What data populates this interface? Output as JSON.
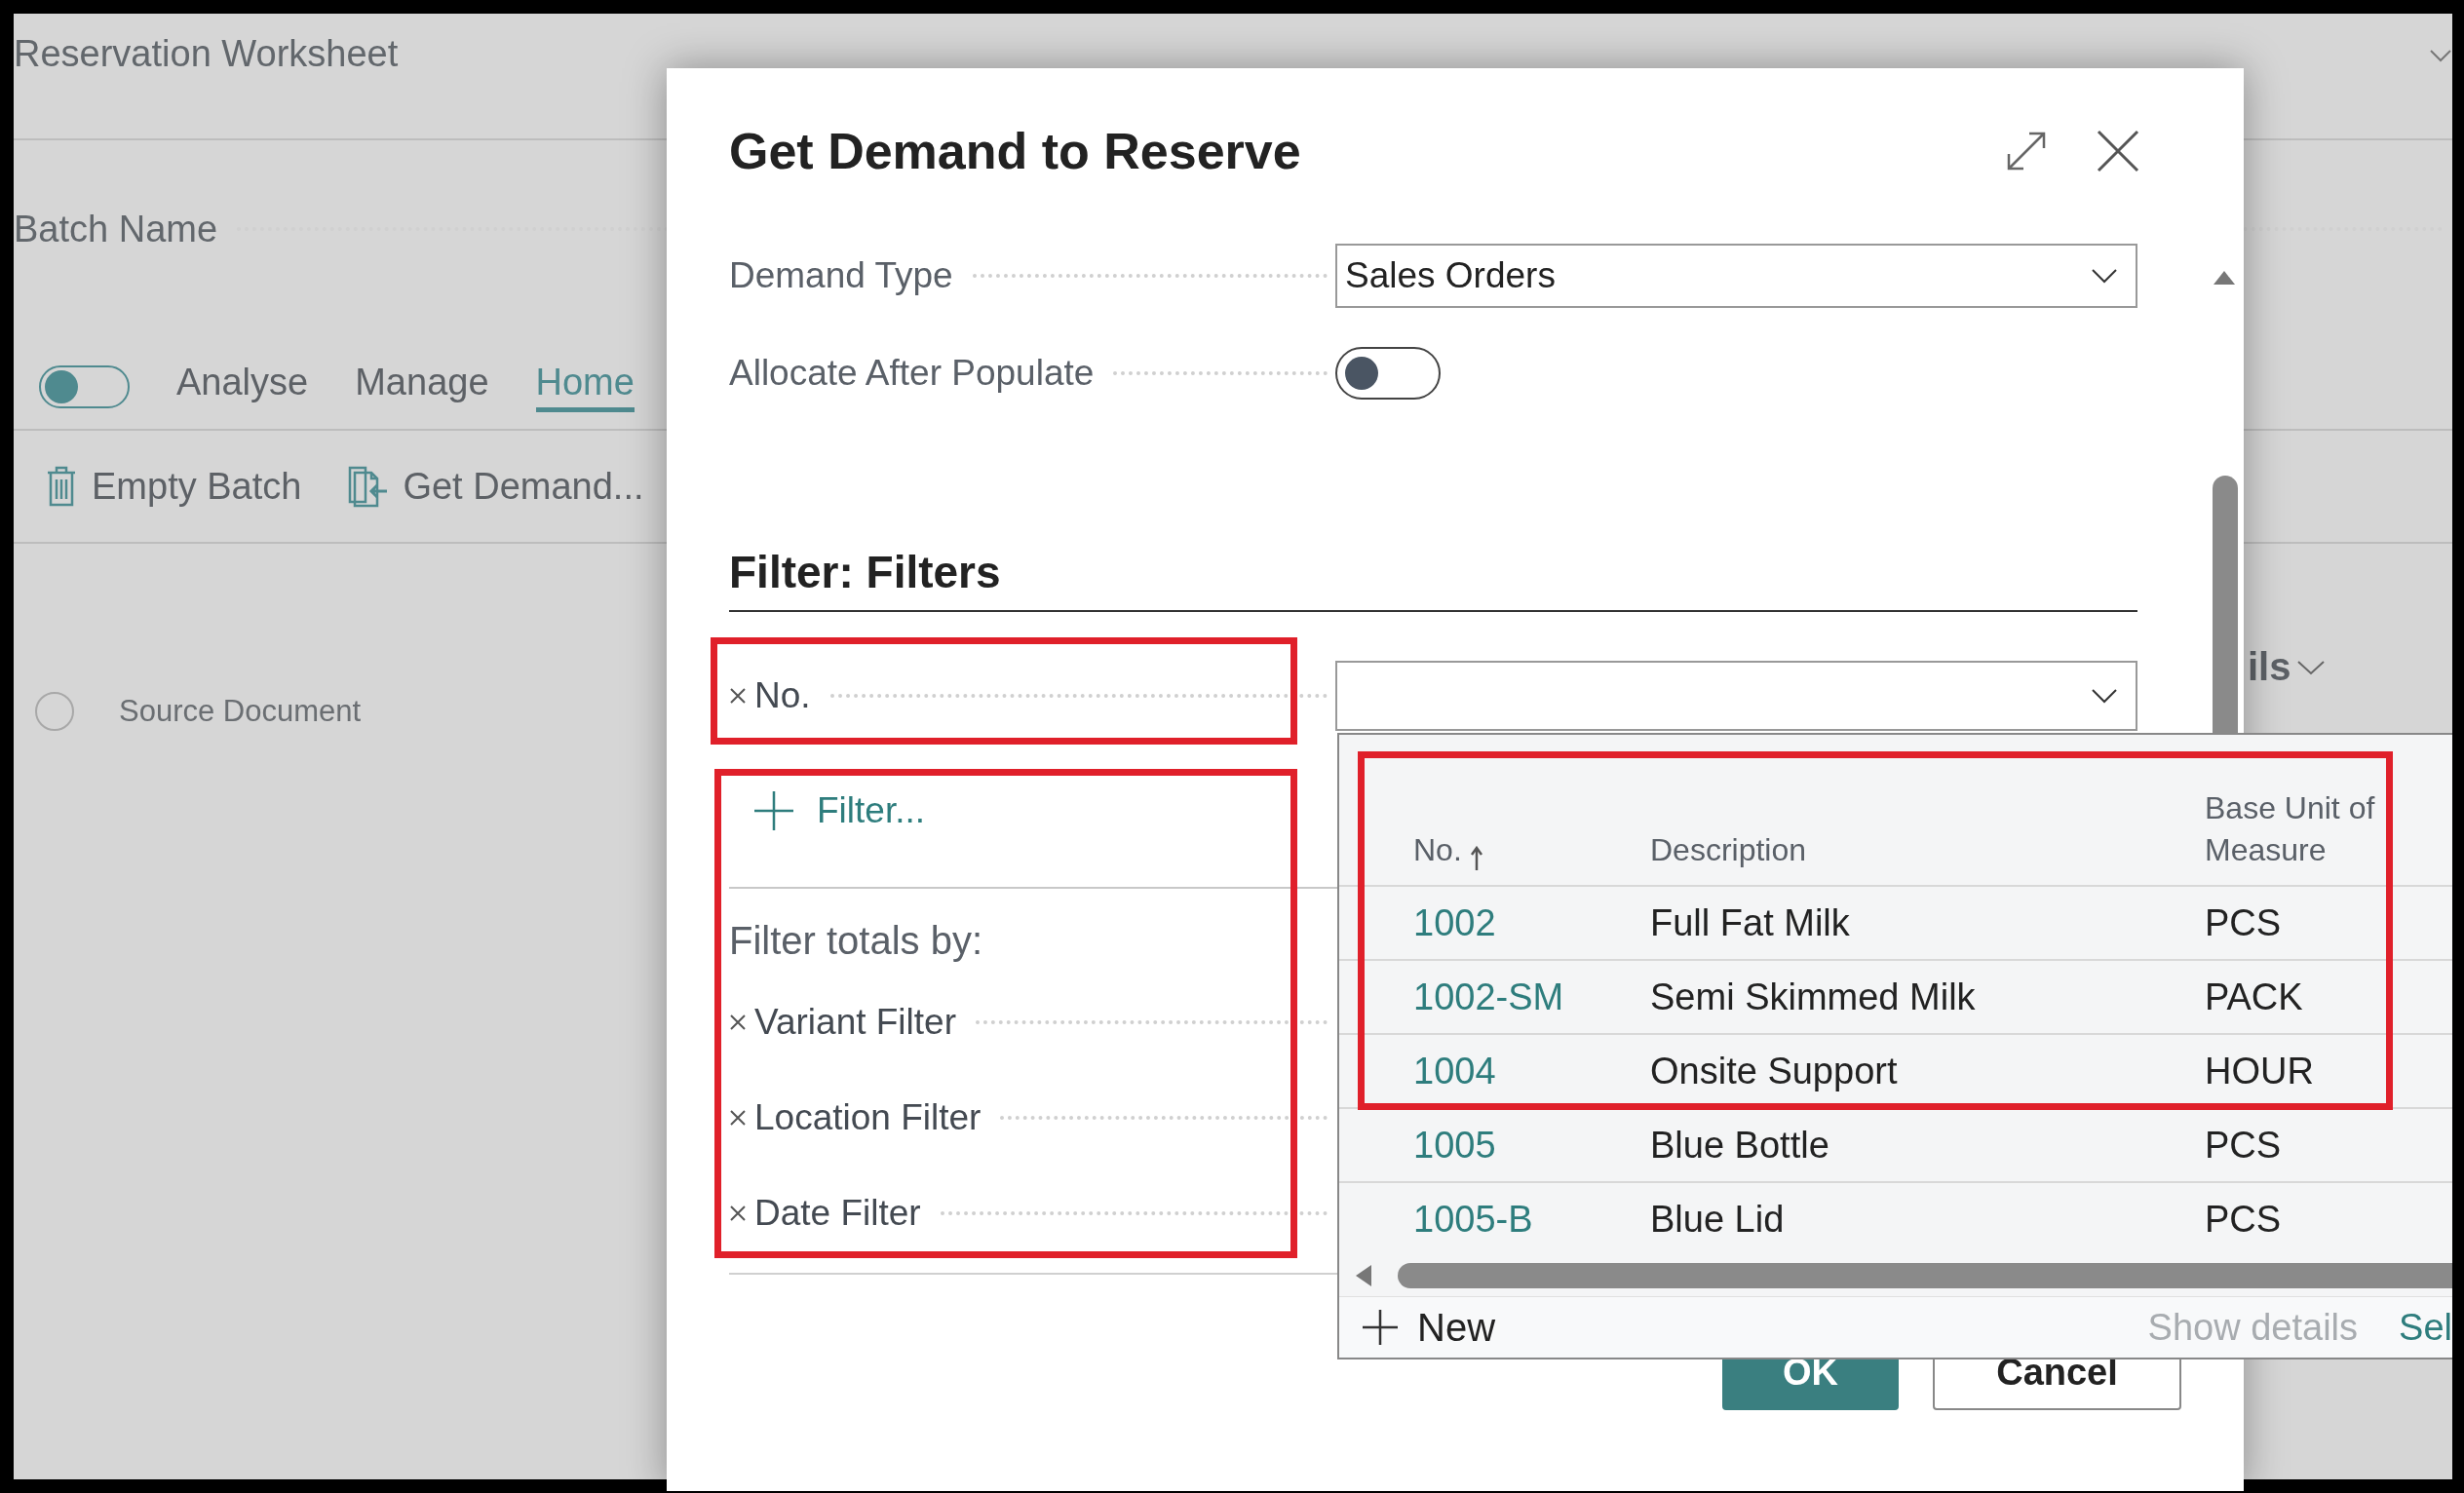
{
  "background_page": {
    "title": "Reservation Worksheet",
    "batch_name_label": "Batch Name",
    "view_toggle": {
      "on": false
    },
    "tabs": [
      {
        "label": "Analyse",
        "selected": false
      },
      {
        "label": "Manage",
        "selected": false
      },
      {
        "label": "Home",
        "selected": true
      }
    ],
    "actions": [
      {
        "label": "Empty Batch",
        "kind": "trash"
      },
      {
        "label": "Get Demand...",
        "kind": "document"
      }
    ],
    "list_header": {
      "label": "Source Document",
      "checked": false
    },
    "side_section": {
      "label": "ils"
    }
  },
  "dialog": {
    "title": "Get Demand to Reserve",
    "fields": [
      {
        "kind": "dropdown",
        "label": "Demand Type",
        "value": "Sales Orders"
      },
      {
        "kind": "toggle",
        "label": "Allocate After Populate",
        "on": false
      }
    ],
    "filter_heading": "Filter: Filters",
    "filters": [
      {
        "label": "No."
      }
    ],
    "add_filter": "Filter...",
    "totals_heading": "Filter totals by:",
    "totals_filters": [
      {
        "label": "Variant Filter"
      },
      {
        "label": "Location Filter"
      },
      {
        "label": "Date Filter"
      }
    ],
    "buttons": [
      {
        "label": "OK",
        "primary": true
      },
      {
        "label": "Cancel",
        "primary": false
      }
    ]
  },
  "lookup": {
    "columns": [
      {
        "label": "No.",
        "sorted": true
      },
      {
        "label": "Description",
        "sorted": false
      },
      {
        "label": "Base Unit of Measure",
        "sorted": false
      }
    ],
    "rows": [
      {
        "no": "1002",
        "description": "Full Fat Milk",
        "unit": "PCS"
      },
      {
        "no": "1002-SM",
        "description": "Semi Skimmed Milk",
        "unit": "PACK"
      },
      {
        "no": "1004",
        "description": "Onsite Support",
        "unit": "HOUR"
      },
      {
        "no": "1005",
        "description": "Blue Bottle",
        "unit": "PCS"
      },
      {
        "no": "1005-B",
        "description": "Blue Lid",
        "unit": "PCS"
      }
    ],
    "footer": {
      "new": "New",
      "show_details": "Show details",
      "select": "Sel"
    }
  }
}
